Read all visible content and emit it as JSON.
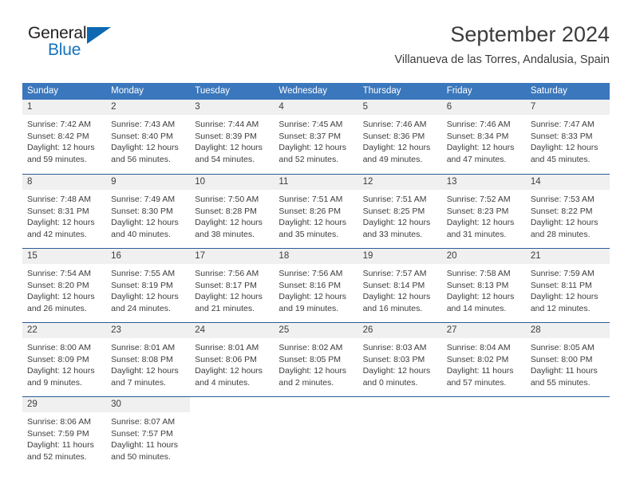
{
  "logo": {
    "text_primary": "General",
    "text_secondary": "Blue",
    "triangle_icon": "triangle-icon",
    "primary_color": "#231f20",
    "secondary_color": "#1673be",
    "triangle_color": "#0d68b1"
  },
  "header": {
    "month_title": "September 2024",
    "location": "Villanueva de las Torres, Andalusia, Spain"
  },
  "theme": {
    "header_blue": "#3b77bc",
    "row_border_blue": "#2a5d96",
    "day_band_gray": "#f0f0f0",
    "text_gray": "#3c3c3c"
  },
  "calendar": {
    "weekdays": [
      "Sunday",
      "Monday",
      "Tuesday",
      "Wednesday",
      "Thursday",
      "Friday",
      "Saturday"
    ],
    "weeks": [
      [
        {
          "day": "1",
          "lines": [
            "Sunrise: 7:42 AM",
            "Sunset: 8:42 PM",
            "Daylight: 12 hours",
            "and 59 minutes."
          ]
        },
        {
          "day": "2",
          "lines": [
            "Sunrise: 7:43 AM",
            "Sunset: 8:40 PM",
            "Daylight: 12 hours",
            "and 56 minutes."
          ]
        },
        {
          "day": "3",
          "lines": [
            "Sunrise: 7:44 AM",
            "Sunset: 8:39 PM",
            "Daylight: 12 hours",
            "and 54 minutes."
          ]
        },
        {
          "day": "4",
          "lines": [
            "Sunrise: 7:45 AM",
            "Sunset: 8:37 PM",
            "Daylight: 12 hours",
            "and 52 minutes."
          ]
        },
        {
          "day": "5",
          "lines": [
            "Sunrise: 7:46 AM",
            "Sunset: 8:36 PM",
            "Daylight: 12 hours",
            "and 49 minutes."
          ]
        },
        {
          "day": "6",
          "lines": [
            "Sunrise: 7:46 AM",
            "Sunset: 8:34 PM",
            "Daylight: 12 hours",
            "and 47 minutes."
          ]
        },
        {
          "day": "7",
          "lines": [
            "Sunrise: 7:47 AM",
            "Sunset: 8:33 PM",
            "Daylight: 12 hours",
            "and 45 minutes."
          ]
        }
      ],
      [
        {
          "day": "8",
          "lines": [
            "Sunrise: 7:48 AM",
            "Sunset: 8:31 PM",
            "Daylight: 12 hours",
            "and 42 minutes."
          ]
        },
        {
          "day": "9",
          "lines": [
            "Sunrise: 7:49 AM",
            "Sunset: 8:30 PM",
            "Daylight: 12 hours",
            "and 40 minutes."
          ]
        },
        {
          "day": "10",
          "lines": [
            "Sunrise: 7:50 AM",
            "Sunset: 8:28 PM",
            "Daylight: 12 hours",
            "and 38 minutes."
          ]
        },
        {
          "day": "11",
          "lines": [
            "Sunrise: 7:51 AM",
            "Sunset: 8:26 PM",
            "Daylight: 12 hours",
            "and 35 minutes."
          ]
        },
        {
          "day": "12",
          "lines": [
            "Sunrise: 7:51 AM",
            "Sunset: 8:25 PM",
            "Daylight: 12 hours",
            "and 33 minutes."
          ]
        },
        {
          "day": "13",
          "lines": [
            "Sunrise: 7:52 AM",
            "Sunset: 8:23 PM",
            "Daylight: 12 hours",
            "and 31 minutes."
          ]
        },
        {
          "day": "14",
          "lines": [
            "Sunrise: 7:53 AM",
            "Sunset: 8:22 PM",
            "Daylight: 12 hours",
            "and 28 minutes."
          ]
        }
      ],
      [
        {
          "day": "15",
          "lines": [
            "Sunrise: 7:54 AM",
            "Sunset: 8:20 PM",
            "Daylight: 12 hours",
            "and 26 minutes."
          ]
        },
        {
          "day": "16",
          "lines": [
            "Sunrise: 7:55 AM",
            "Sunset: 8:19 PM",
            "Daylight: 12 hours",
            "and 24 minutes."
          ]
        },
        {
          "day": "17",
          "lines": [
            "Sunrise: 7:56 AM",
            "Sunset: 8:17 PM",
            "Daylight: 12 hours",
            "and 21 minutes."
          ]
        },
        {
          "day": "18",
          "lines": [
            "Sunrise: 7:56 AM",
            "Sunset: 8:16 PM",
            "Daylight: 12 hours",
            "and 19 minutes."
          ]
        },
        {
          "day": "19",
          "lines": [
            "Sunrise: 7:57 AM",
            "Sunset: 8:14 PM",
            "Daylight: 12 hours",
            "and 16 minutes."
          ]
        },
        {
          "day": "20",
          "lines": [
            "Sunrise: 7:58 AM",
            "Sunset: 8:13 PM",
            "Daylight: 12 hours",
            "and 14 minutes."
          ]
        },
        {
          "day": "21",
          "lines": [
            "Sunrise: 7:59 AM",
            "Sunset: 8:11 PM",
            "Daylight: 12 hours",
            "and 12 minutes."
          ]
        }
      ],
      [
        {
          "day": "22",
          "lines": [
            "Sunrise: 8:00 AM",
            "Sunset: 8:09 PM",
            "Daylight: 12 hours",
            "and 9 minutes."
          ]
        },
        {
          "day": "23",
          "lines": [
            "Sunrise: 8:01 AM",
            "Sunset: 8:08 PM",
            "Daylight: 12 hours",
            "and 7 minutes."
          ]
        },
        {
          "day": "24",
          "lines": [
            "Sunrise: 8:01 AM",
            "Sunset: 8:06 PM",
            "Daylight: 12 hours",
            "and 4 minutes."
          ]
        },
        {
          "day": "25",
          "lines": [
            "Sunrise: 8:02 AM",
            "Sunset: 8:05 PM",
            "Daylight: 12 hours",
            "and 2 minutes."
          ]
        },
        {
          "day": "26",
          "lines": [
            "Sunrise: 8:03 AM",
            "Sunset: 8:03 PM",
            "Daylight: 12 hours",
            "and 0 minutes."
          ]
        },
        {
          "day": "27",
          "lines": [
            "Sunrise: 8:04 AM",
            "Sunset: 8:02 PM",
            "Daylight: 11 hours",
            "and 57 minutes."
          ]
        },
        {
          "day": "28",
          "lines": [
            "Sunrise: 8:05 AM",
            "Sunset: 8:00 PM",
            "Daylight: 11 hours",
            "and 55 minutes."
          ]
        }
      ],
      [
        {
          "day": "29",
          "lines": [
            "Sunrise: 8:06 AM",
            "Sunset: 7:59 PM",
            "Daylight: 11 hours",
            "and 52 minutes."
          ]
        },
        {
          "day": "30",
          "lines": [
            "Sunrise: 8:07 AM",
            "Sunset: 7:57 PM",
            "Daylight: 11 hours",
            "and 50 minutes."
          ]
        },
        {
          "day": "",
          "lines": []
        },
        {
          "day": "",
          "lines": []
        },
        {
          "day": "",
          "lines": []
        },
        {
          "day": "",
          "lines": []
        },
        {
          "day": "",
          "lines": []
        }
      ]
    ]
  }
}
